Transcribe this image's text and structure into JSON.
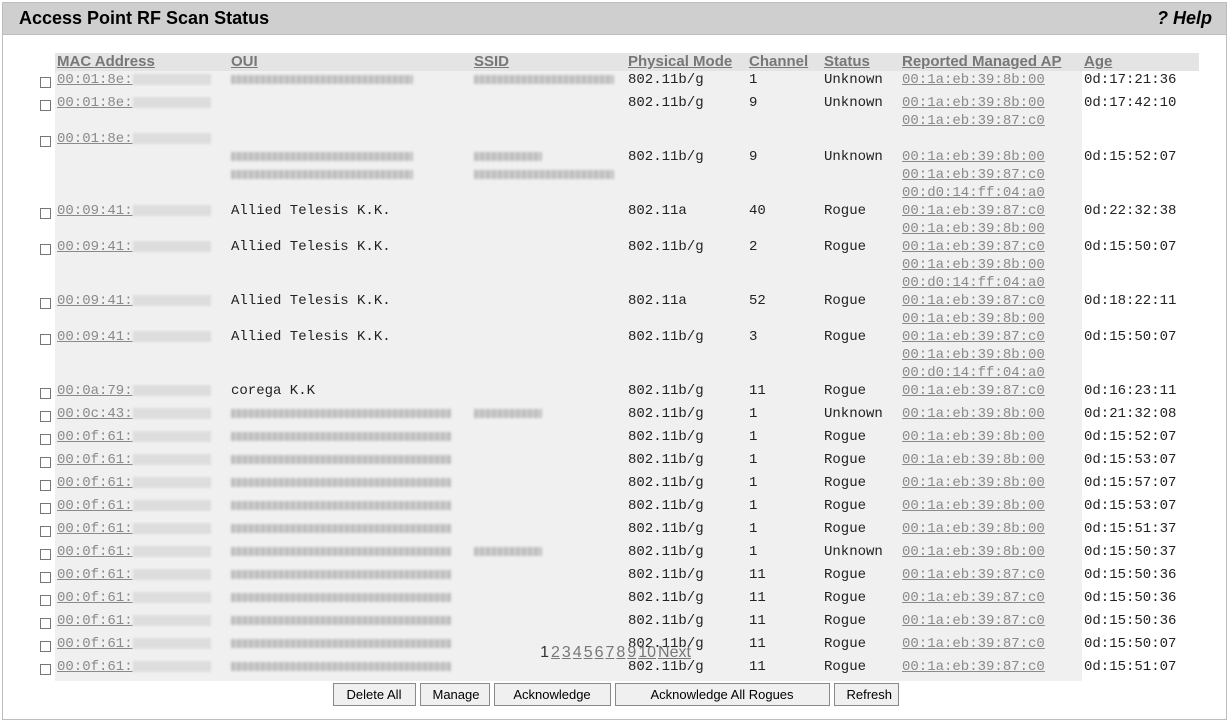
{
  "header": {
    "title": "Access Point RF Scan Status",
    "help": "? Help"
  },
  "columns": [
    "MAC Address",
    "OUI",
    "SSID",
    "Physical Mode",
    "Channel",
    "Status",
    "Reported Managed AP",
    "Age"
  ],
  "rows": [
    {
      "mac": "00:01:8e:",
      "oui": "",
      "oui_blur": "l",
      "ssid_blur": "l",
      "mode": "802.11b/g",
      "channel": "1",
      "status": "Unknown",
      "aps": [
        "00:1a:eb:39:8b:00"
      ],
      "age": "0d:17:21:36"
    },
    {
      "mac": "00:01:8e:",
      "oui": "",
      "oui_blur": "",
      "ssid_blur": "",
      "mode": "802.11b/g",
      "channel": "9",
      "status": "Unknown",
      "aps": [
        "00:1a:eb:39:8b:00",
        "00:1a:eb:39:87:c0"
      ],
      "age": "0d:17:42:10"
    },
    {
      "mac": "00:01:8e:",
      "oui": "",
      "oui_blur": "l2",
      "ssid_blur": "l2",
      "mode": "802.11b/g",
      "channel": "9",
      "status": "Unknown",
      "aps": [
        "00:1a:eb:39:8b:00",
        "00:1a:eb:39:87:c0",
        "00:d0:14:ff:04:a0"
      ],
      "age": "0d:15:52:07"
    },
    {
      "mac": "00:09:41:",
      "oui": "Allied Telesis K.K.",
      "oui_blur": "",
      "ssid_blur": "",
      "mode": "802.11a",
      "channel": "40",
      "status": "Rogue",
      "aps": [
        "00:1a:eb:39:87:c0",
        "00:1a:eb:39:8b:00"
      ],
      "age": "0d:22:32:38"
    },
    {
      "mac": "00:09:41:",
      "oui": "Allied Telesis K.K.",
      "oui_blur": "",
      "ssid_blur": "",
      "mode": "802.11b/g",
      "channel": "2",
      "status": "Rogue",
      "aps": [
        "00:1a:eb:39:87:c0",
        "00:1a:eb:39:8b:00",
        "00:d0:14:ff:04:a0"
      ],
      "age": "0d:15:50:07"
    },
    {
      "mac": "00:09:41:",
      "oui": "Allied Telesis K.K.",
      "oui_blur": "",
      "ssid_blur": "",
      "mode": "802.11a",
      "channel": "52",
      "status": "Rogue",
      "aps": [
        "00:1a:eb:39:87:c0",
        "00:1a:eb:39:8b:00"
      ],
      "age": "0d:18:22:11"
    },
    {
      "mac": "00:09:41:",
      "oui": "Allied Telesis K.K.",
      "oui_blur": "",
      "ssid_blur": "",
      "mode": "802.11b/g",
      "channel": "3",
      "status": "Rogue",
      "aps": [
        "00:1a:eb:39:87:c0",
        "00:1a:eb:39:8b:00",
        "00:d0:14:ff:04:a0"
      ],
      "age": "0d:15:50:07"
    },
    {
      "mac": "00:0a:79:",
      "oui": "corega K.K",
      "oui_blur": "",
      "ssid_blur": "",
      "mode": "802.11b/g",
      "channel": "11",
      "status": "Rogue",
      "aps": [
        "00:1a:eb:39:87:c0"
      ],
      "age": "0d:16:23:11"
    },
    {
      "mac": "00:0c:43:",
      "oui": "",
      "oui_blur": "m",
      "ssid_blur": "s",
      "mode": "802.11b/g",
      "channel": "1",
      "status": "Unknown",
      "aps": [
        "00:1a:eb:39:8b:00"
      ],
      "age": "0d:21:32:08"
    },
    {
      "mac": "00:0f:61:",
      "oui": "",
      "oui_blur": "m",
      "ssid_blur": "",
      "mode": "802.11b/g",
      "channel": "1",
      "status": "Rogue",
      "aps": [
        "00:1a:eb:39:8b:00"
      ],
      "age": "0d:15:52:07"
    },
    {
      "mac": "00:0f:61:",
      "oui": "",
      "oui_blur": "m",
      "ssid_blur": "",
      "mode": "802.11b/g",
      "channel": "1",
      "status": "Rogue",
      "aps": [
        "00:1a:eb:39:8b:00"
      ],
      "age": "0d:15:53:07"
    },
    {
      "mac": "00:0f:61:",
      "oui": "",
      "oui_blur": "m",
      "ssid_blur": "",
      "mode": "802.11b/g",
      "channel": "1",
      "status": "Rogue",
      "aps": [
        "00:1a:eb:39:8b:00"
      ],
      "age": "0d:15:57:07"
    },
    {
      "mac": "00:0f:61:",
      "oui": "",
      "oui_blur": "m",
      "ssid_blur": "",
      "mode": "802.11b/g",
      "channel": "1",
      "status": "Rogue",
      "aps": [
        "00:1a:eb:39:8b:00"
      ],
      "age": "0d:15:53:07"
    },
    {
      "mac": "00:0f:61:",
      "oui": "",
      "oui_blur": "m",
      "ssid_blur": "",
      "mode": "802.11b/g",
      "channel": "1",
      "status": "Rogue",
      "aps": [
        "00:1a:eb:39:8b:00"
      ],
      "age": "0d:15:51:37"
    },
    {
      "mac": "00:0f:61:",
      "oui": "",
      "oui_blur": "m",
      "ssid_blur": "s",
      "mode": "802.11b/g",
      "channel": "1",
      "status": "Unknown",
      "aps": [
        "00:1a:eb:39:8b:00"
      ],
      "age": "0d:15:50:37"
    },
    {
      "mac": "00:0f:61:",
      "oui": "",
      "oui_blur": "m",
      "ssid_blur": "",
      "mode": "802.11b/g",
      "channel": "11",
      "status": "Rogue",
      "aps": [
        "00:1a:eb:39:87:c0"
      ],
      "age": "0d:15:50:36"
    },
    {
      "mac": "00:0f:61:",
      "oui": "",
      "oui_blur": "m",
      "ssid_blur": "",
      "mode": "802.11b/g",
      "channel": "11",
      "status": "Rogue",
      "aps": [
        "00:1a:eb:39:87:c0"
      ],
      "age": "0d:15:50:36"
    },
    {
      "mac": "00:0f:61:",
      "oui": "",
      "oui_blur": "m",
      "ssid_blur": "",
      "mode": "802.11b/g",
      "channel": "11",
      "status": "Rogue",
      "aps": [
        "00:1a:eb:39:87:c0"
      ],
      "age": "0d:15:50:36"
    },
    {
      "mac": "00:0f:61:",
      "oui": "",
      "oui_blur": "m",
      "ssid_blur": "",
      "mode": "802.11b/g",
      "channel": "11",
      "status": "Rogue",
      "aps": [
        "00:1a:eb:39:87:c0"
      ],
      "age": "0d:15:50:07"
    },
    {
      "mac": "00:0f:61:",
      "oui": "",
      "oui_blur": "m",
      "ssid_blur": "",
      "mode": "802.11b/g",
      "channel": "11",
      "status": "Rogue",
      "aps": [
        "00:1a:eb:39:87:c0"
      ],
      "age": "0d:15:51:07"
    }
  ],
  "pagination": {
    "pages": [
      "1",
      "2",
      "3",
      "4",
      "5",
      "6",
      "7",
      "8",
      "9",
      "10"
    ],
    "current": "1",
    "next": "Next"
  },
  "buttons": {
    "delete_all": "Delete All",
    "manage": "Manage",
    "acknowledge": "Acknowledge",
    "ack_all_rogues": "Acknowledge All Rogues",
    "refresh": "Refresh"
  }
}
